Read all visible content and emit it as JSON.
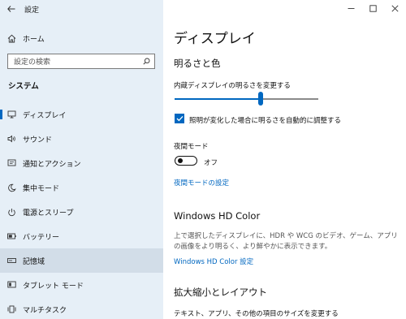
{
  "window": {
    "title": "設定"
  },
  "sidebar": {
    "home_label": "ホーム",
    "search_placeholder": "設定の検索",
    "section": "システム",
    "items": [
      {
        "label": "ディスプレイ",
        "icon": "display-icon"
      },
      {
        "label": "サウンド",
        "icon": "speaker-icon"
      },
      {
        "label": "通知とアクション",
        "icon": "notification-icon"
      },
      {
        "label": "集中モード",
        "icon": "moon-icon"
      },
      {
        "label": "電源とスリープ",
        "icon": "power-icon"
      },
      {
        "label": "バッテリー",
        "icon": "battery-icon"
      },
      {
        "label": "記憶域",
        "icon": "storage-icon"
      },
      {
        "label": "タブレット モード",
        "icon": "tablet-icon"
      },
      {
        "label": "マルチタスク",
        "icon": "multitask-icon"
      }
    ]
  },
  "main": {
    "title": "ディスプレイ",
    "brightness_heading": "明るさと色",
    "brightness_label": "内蔵ディスプレイの明るさを変更する",
    "brightness_value": 0.6,
    "auto_brightness_label": "照明が変化した場合に明るさを自動的に調整する",
    "auto_brightness_checked": true,
    "night_mode_label": "夜間モード",
    "night_mode_state": "オフ",
    "night_mode_settings_link": "夜間モードの設定",
    "hdr_heading": "Windows HD Color",
    "hdr_desc": "上で選択したディスプレイに、HDR や WCG のビデオ、ゲーム、アプリの画像をより明るく、より鮮やかに表示できます。",
    "hdr_link": "Windows HD Color 設定",
    "scale_heading": "拡大縮小とレイアウト",
    "scale_label": "テキスト、アプリ、その他の項目のサイズを変更する"
  },
  "colors": {
    "accent": "#0067c0",
    "sidebar_bg": "#e6eff7",
    "hover_bg": "#d2dde8"
  }
}
